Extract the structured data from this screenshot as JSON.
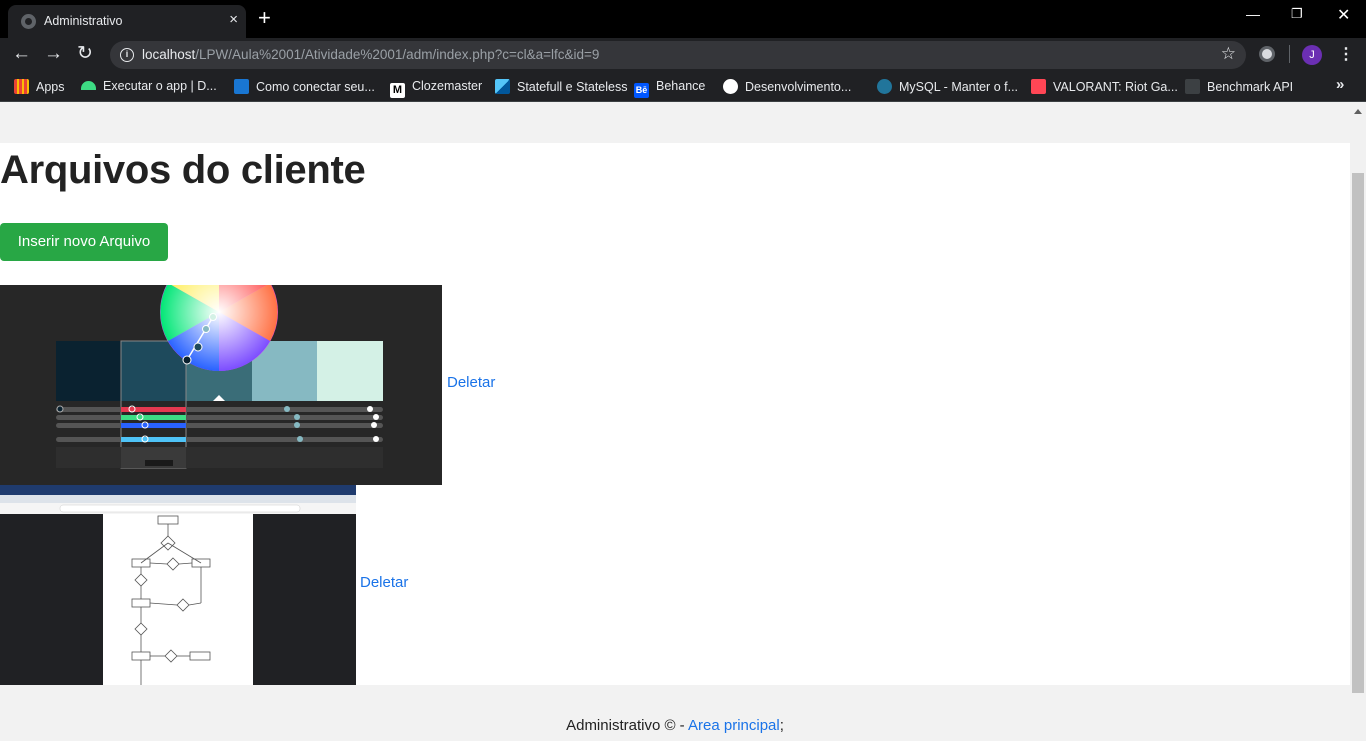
{
  "browser": {
    "tab_title": "Administrativo",
    "tab_close": "×",
    "new_tab": "+",
    "url_host": "localhost",
    "url_path": "/LPW/Aula%2001/Atividade%2001/adm/index.php?c=cl&a=lfc&id=9",
    "avatar_initial": "J",
    "bookmarks": [
      {
        "label": "Apps",
        "color": "#ea4335"
      },
      {
        "label": "Executar o app | D...",
        "color": "#3ddc84"
      },
      {
        "label": "Como conectar seu...",
        "color": "#1976d2"
      },
      {
        "label": "Clozemaster",
        "color": "#ffffff"
      },
      {
        "label": "Statefull e Stateless",
        "color": "#54c5f8"
      },
      {
        "label": "Behance",
        "color": "#0057ff"
      },
      {
        "label": "Desenvolvimento...",
        "color": "#ffffff"
      },
      {
        "label": "MySQL - Manter o f...",
        "color": "#21759b"
      },
      {
        "label": "VALORANT: Riot Ga...",
        "color": "#ff4655"
      },
      {
        "label": "Benchmark API",
        "color": "#3c4043"
      }
    ]
  },
  "page": {
    "heading": "Arquivos do cliente",
    "insert_button": "Inserir novo Arquivo",
    "files": [
      {
        "delete_label": "Deletar"
      },
      {
        "delete_label": "Deletar"
      }
    ],
    "footer_text": "Administrativo © - ",
    "footer_link": "Area principal",
    "footer_suffix": ";"
  }
}
